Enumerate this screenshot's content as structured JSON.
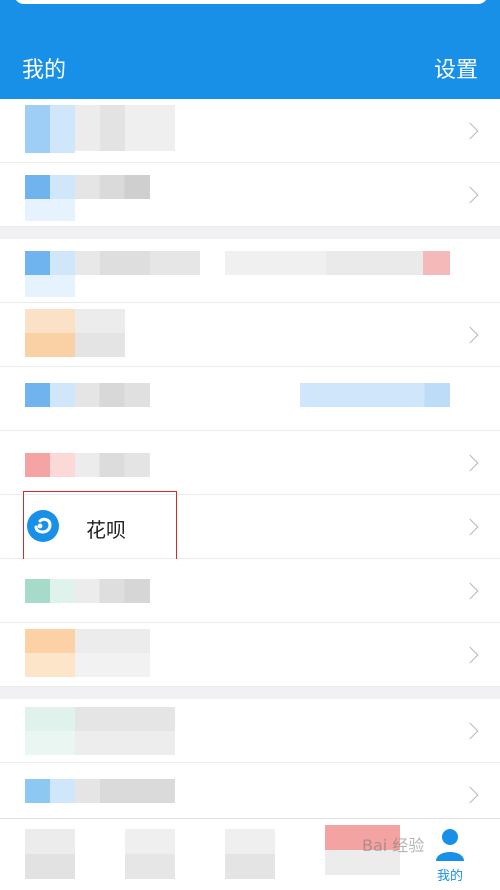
{
  "header": {
    "title": "我的",
    "settings_label": "设置"
  },
  "huabei": {
    "label": "花呗"
  },
  "tabbar": {
    "me_label": "我的"
  },
  "watermark": {
    "text": "Bai 经验"
  },
  "colors": {
    "brand": "#1890e8",
    "highlight": "#d12c2c"
  }
}
